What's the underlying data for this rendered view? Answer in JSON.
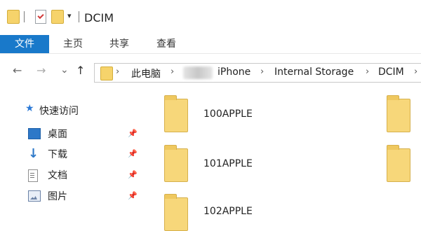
{
  "window": {
    "title": "DCIM",
    "quick_access_dropdown": "▾"
  },
  "ribbon": {
    "tabs": [
      "文件",
      "主页",
      "共享",
      "查看"
    ]
  },
  "address": {
    "nav_back": "←",
    "nav_forward": "→",
    "nav_recent": "⌄",
    "nav_up": "↑",
    "breadcrumb": [
      "此电脑",
      "iPhone",
      "Internal Storage",
      "DCIM"
    ],
    "separator": "›"
  },
  "sidebar": {
    "header": "快速访问",
    "items": [
      "桌面",
      "下载",
      "文档",
      "图片"
    ],
    "pin_icon": "📌"
  },
  "content": {
    "folders": [
      "100APPLE",
      "101APPLE",
      "102APPLE"
    ]
  },
  "colors": {
    "accent": "#1979ca",
    "folder": "#f7d77a"
  }
}
